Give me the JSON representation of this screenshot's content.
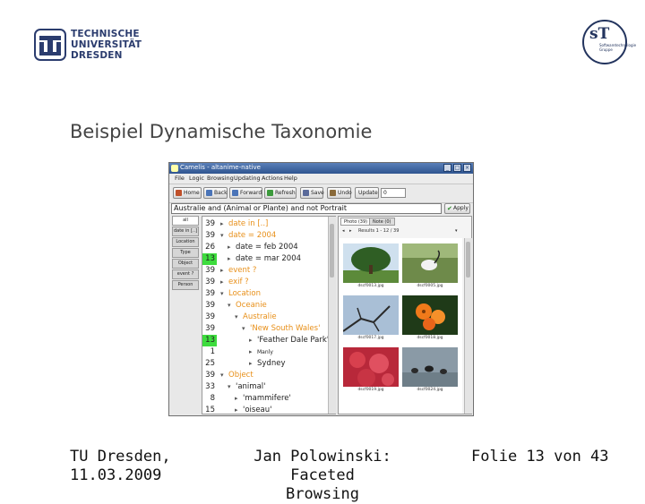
{
  "header": {
    "university_logo_lines": [
      "TECHNISCHE",
      "UNIVERSITÄT",
      "DRESDEN"
    ],
    "group_logo": {
      "monogram": "sT",
      "lines": [
        "Softwaretechnologie",
        "Gruppe"
      ]
    }
  },
  "slide": {
    "title": "Beispiel Dynamische Taxonomie"
  },
  "app": {
    "window_title": "Camelis - altanime-native",
    "menu": [
      "File",
      "Logic",
      "Browsing",
      "Updating",
      "Actions",
      "Help"
    ],
    "toolbar": {
      "home": "Home",
      "back": "Back",
      "forward": "Forward",
      "refresh": "Refresh",
      "save": "Save",
      "undo": "Undo",
      "update": "Update",
      "update_value": "0"
    },
    "query": "Australie and (Animal or Plante) and not Portrait",
    "apply_label": "Apply",
    "facet_tabs": [
      "all",
      "date in [..]",
      "Location",
      "Type",
      "Object",
      "event ?",
      "Person"
    ],
    "tree": [
      {
        "count": "39",
        "arrow": "▸",
        "label": "date in [..]",
        "cat": true,
        "hl": false
      },
      {
        "count": "39",
        "arrow": "▾",
        "label": "date = 2004",
        "cat": true,
        "hl": false
      },
      {
        "count": "26",
        "arrow": "▸",
        "label": "date = feb 2004",
        "cat": false,
        "hl": false
      },
      {
        "count": "13",
        "arrow": "▸",
        "label": "date = mar 2004",
        "cat": false,
        "hl": true
      },
      {
        "count": "39",
        "arrow": "▸",
        "label": "event ?",
        "cat": true,
        "hl": false
      },
      {
        "count": "39",
        "arrow": "▸",
        "label": "exif ?",
        "cat": true,
        "hl": false
      },
      {
        "count": "39",
        "arrow": "▾",
        "label": "Location",
        "cat": true,
        "hl": false
      },
      {
        "count": "39",
        "arrow": "▾",
        "label": "Oceanie",
        "cat": true,
        "hl": false
      },
      {
        "count": "39",
        "arrow": "▾",
        "label": "Australie",
        "cat": true,
        "hl": false
      },
      {
        "count": "39",
        "arrow": "▾",
        "label": "'New South Wales'",
        "cat": true,
        "hl": false
      },
      {
        "count": "13",
        "arrow": "▸",
        "label": "'Feather Dale Park'",
        "cat": false,
        "hl": true
      },
      {
        "count": "1",
        "arrow": "▸",
        "label": "Manly",
        "cat": false,
        "hl": false
      },
      {
        "count": "25",
        "arrow": "▸",
        "label": "Sydney",
        "cat": false,
        "hl": false
      },
      {
        "count": "39",
        "arrow": "▾",
        "label": "Object",
        "cat": true,
        "hl": false
      },
      {
        "count": "33",
        "arrow": "▾",
        "label": "'animal'",
        "cat": false,
        "hl": false
      },
      {
        "count": "8",
        "arrow": "▸",
        "label": "'mammifere'",
        "cat": false,
        "hl": false
      },
      {
        "count": "15",
        "arrow": "▸",
        "label": "'oiseau'",
        "cat": false,
        "hl": false
      }
    ],
    "photo_tabs": [
      "Photo (39)",
      "Note (0)"
    ],
    "results": "Results  1 - 12 / 39",
    "photos": [
      {
        "caption": "dscf0013.jpg",
        "kind": "tree"
      },
      {
        "caption": "dscf0005.jpg",
        "kind": "bird"
      },
      {
        "caption": "dscf0017.jpg",
        "kind": "branch"
      },
      {
        "caption": "dscf0018.jpg",
        "kind": "flower-orange"
      },
      {
        "caption": "dscf0019.jpg",
        "kind": "flower-red"
      },
      {
        "caption": "dscf0024.jpg",
        "kind": "birds-water"
      }
    ]
  },
  "footer": {
    "left": [
      "TU Dresden,",
      "11.03.2009"
    ],
    "middle": [
      "Jan Polowinski: Faceted",
      "Browsing"
    ],
    "right": "Folie 13 von 43"
  }
}
